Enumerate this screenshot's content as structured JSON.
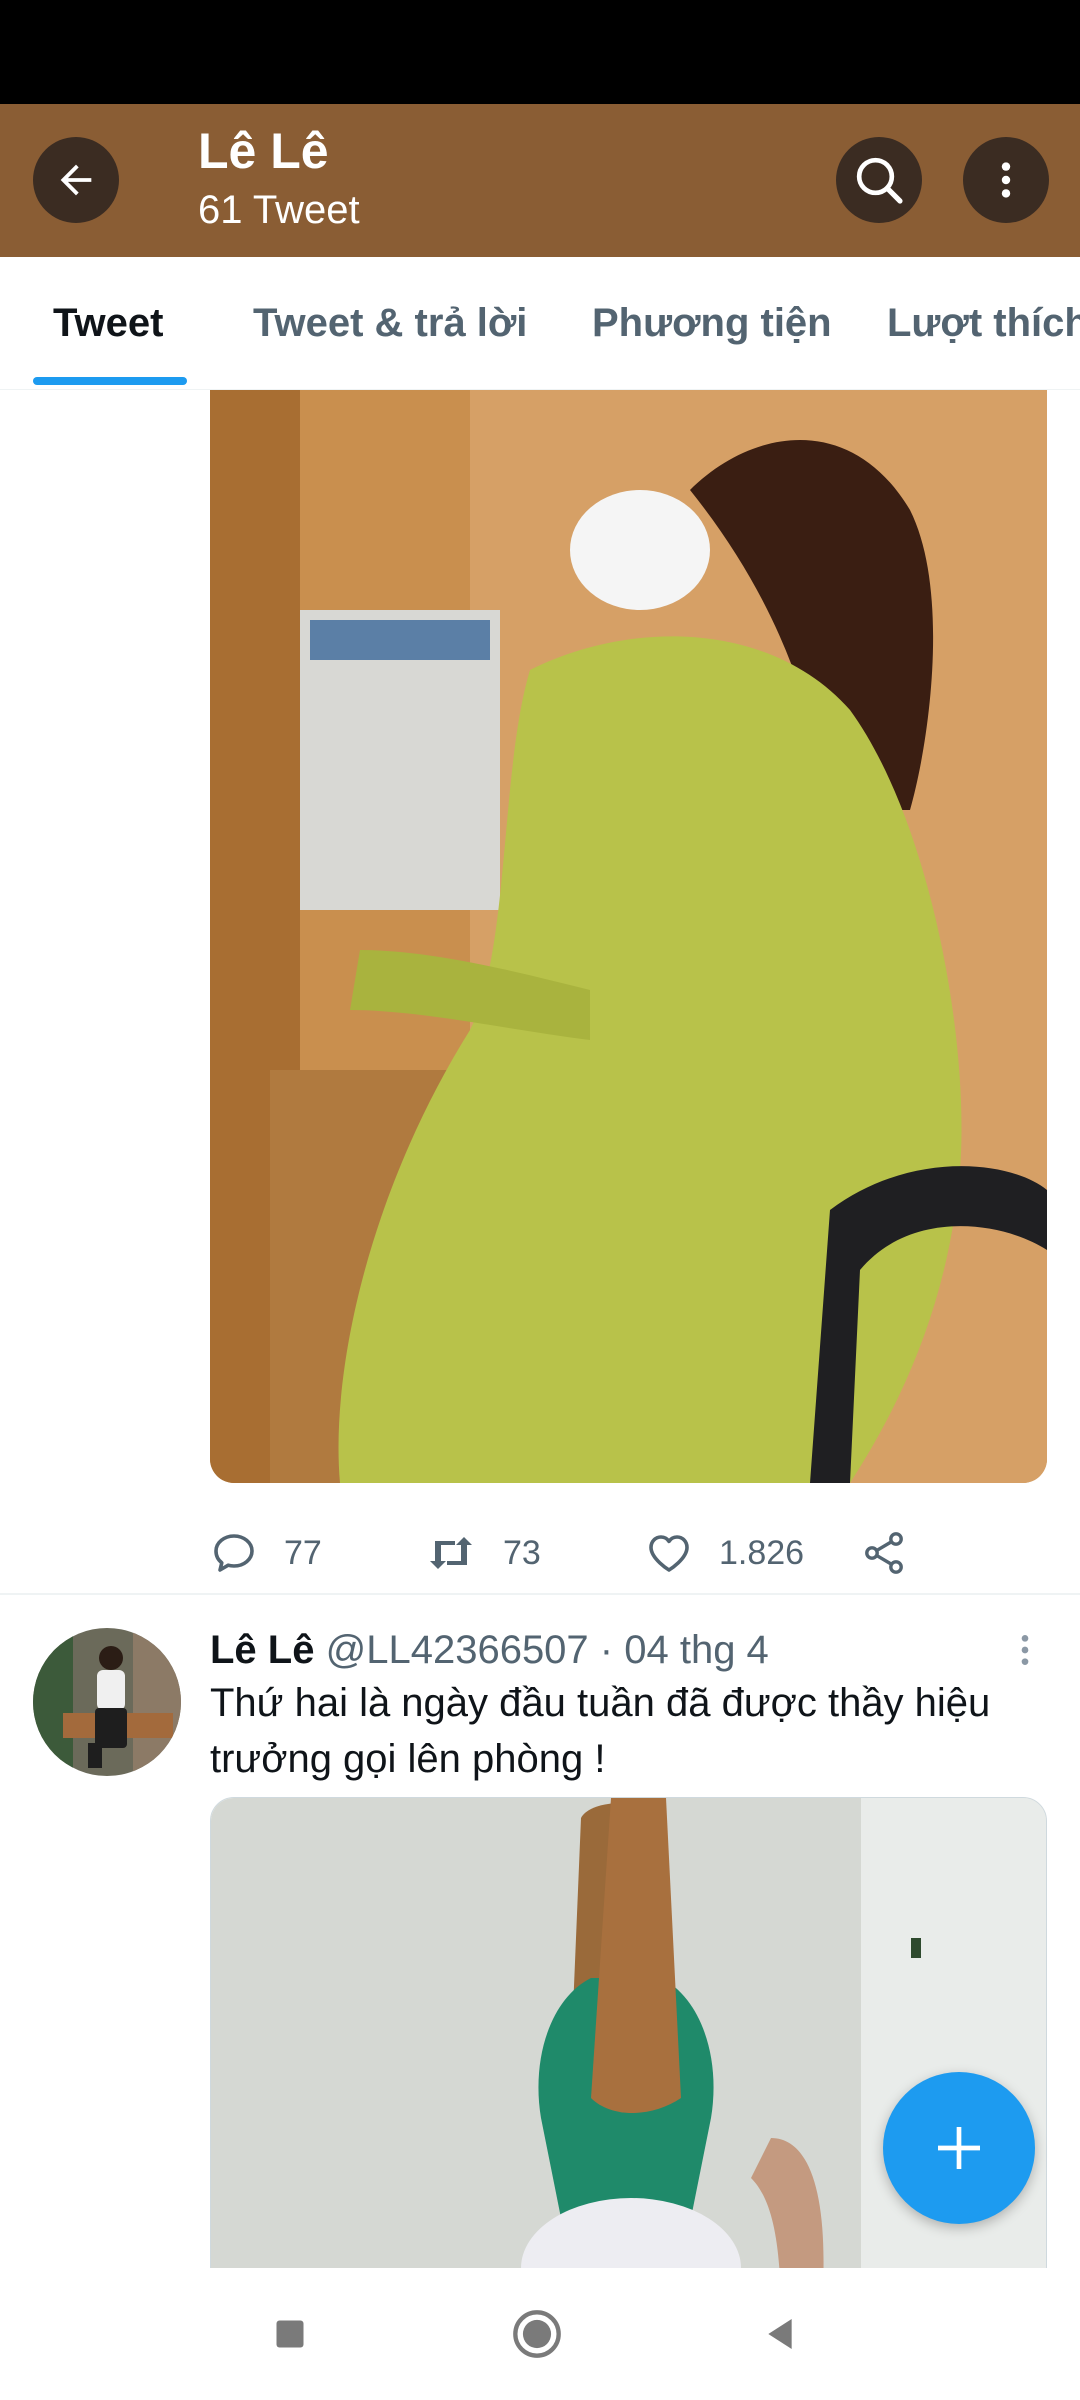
{
  "header": {
    "title": "Lê Lê",
    "subtitle": "61 Tweet",
    "back_icon": "arrow-left-icon",
    "search_icon": "search-icon",
    "more_icon": "more-vertical-icon",
    "background_color": "#8a5d34"
  },
  "tabs": [
    {
      "label": "Tweet",
      "active": true
    },
    {
      "label": "Tweet & trả lời",
      "active": false
    },
    {
      "label": "Phương tiện",
      "active": false
    },
    {
      "label": "Lượt thích",
      "active": false
    }
  ],
  "tweet1": {
    "actions": {
      "reply_count": "77",
      "retweet_count": "73",
      "like_count": "1.826"
    }
  },
  "tweet2": {
    "name": "Lê Lê",
    "meta": "@LL42366507 · 04 thg 4",
    "text": "Thứ hai là ngày đầu tuần đã được thầy hiệu trưởng gọi lên phòng !"
  },
  "colors": {
    "accent": "#1d9bf0",
    "secondary_text": "#536471"
  }
}
